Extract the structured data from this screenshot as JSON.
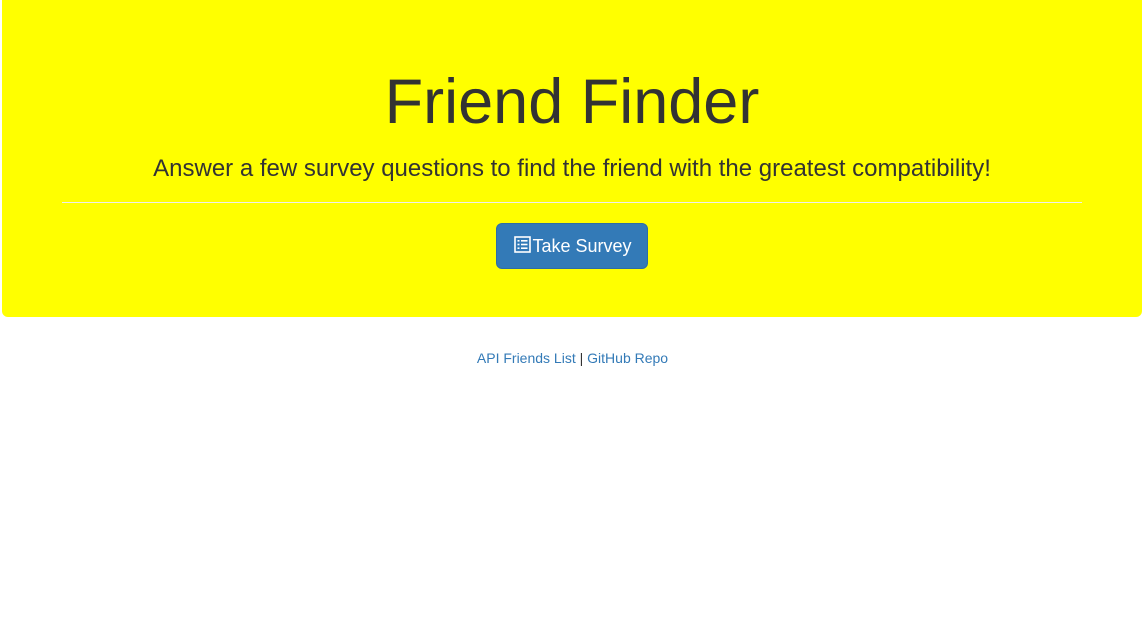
{
  "header": {
    "title": "Friend Finder",
    "subtitle": "Answer a few survey questions to find the friend with the greatest compatibility!",
    "background_color": "#ffff00"
  },
  "survey_button": {
    "icon": "list-alt-icon",
    "label": "Take Survey",
    "color": "#337ab7"
  },
  "footer": {
    "links": [
      {
        "label": "API Friends List"
      },
      {
        "label": "GitHub Repo"
      }
    ],
    "separator": "|",
    "link_color": "#337ab7"
  }
}
